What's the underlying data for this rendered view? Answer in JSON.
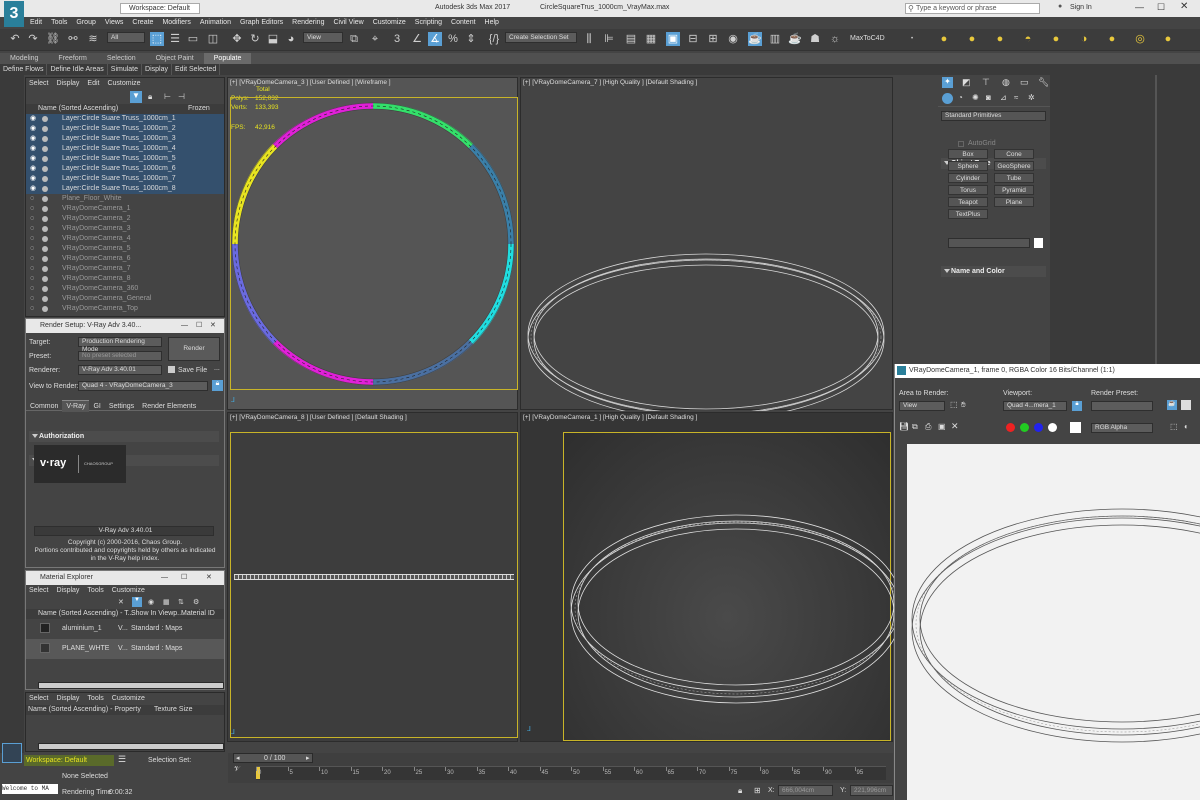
{
  "app": {
    "workspace_label": "Workspace: Default",
    "window_title": "Autodesk 3ds Max 2017",
    "file_name": "CircleSquareTrus_1000cm_VrayMax.max",
    "search_placeholder": "Type a keyword or phrase",
    "sign_in": "Sign In",
    "logo": "3"
  },
  "menu": [
    "Edit",
    "Tools",
    "Group",
    "Views",
    "Create",
    "Modifiers",
    "Animation",
    "Graph Editors",
    "Rendering",
    "Civil View",
    "Customize",
    "Scripting",
    "Content",
    "Help"
  ],
  "toolbar": {
    "selection_filter": "All",
    "ref_coord": "View",
    "named_selection": "Create Selection Set",
    "plugin_label": "MaxToC4D"
  },
  "ribbon_tabs": [
    "Modeling",
    "Freeform",
    "Selection",
    "Object Paint",
    "Populate"
  ],
  "ribbon_subtabs": [
    "Define Flows",
    "Define Idle Areas",
    "Simulate",
    "Display",
    "Edit Selected"
  ],
  "scene_explorer": {
    "menu": [
      "Select",
      "Display",
      "Edit",
      "Customize"
    ],
    "column_name": "Name (Sorted Ascending)",
    "column_frozen": "Frozen",
    "items": [
      {
        "label": "Layer:Circle Suare Truss_1000cm_1",
        "selected": true
      },
      {
        "label": "Layer:Circle Suare Truss_1000cm_2",
        "selected": true
      },
      {
        "label": "Layer:Circle Suare Truss_1000cm_3",
        "selected": true
      },
      {
        "label": "Layer:Circle Suare Truss_1000cm_4",
        "selected": true
      },
      {
        "label": "Layer:Circle Suare Truss_1000cm_5",
        "selected": true
      },
      {
        "label": "Layer:Circle Suare Truss_1000cm_6",
        "selected": true
      },
      {
        "label": "Layer:Circle Suare Truss_1000cm_7",
        "selected": true
      },
      {
        "label": "Layer:Circle Suare Truss_1000cm_8",
        "selected": true
      },
      {
        "label": "Plane_Floor_White",
        "selected": false
      },
      {
        "label": "VRayDomeCamera_1",
        "selected": false
      },
      {
        "label": "VRayDomeCamera_2",
        "selected": false
      },
      {
        "label": "VRayDomeCamera_3",
        "selected": false
      },
      {
        "label": "VRayDomeCamera_4",
        "selected": false
      },
      {
        "label": "VRayDomeCamera_5",
        "selected": false
      },
      {
        "label": "VRayDomeCamera_6",
        "selected": false
      },
      {
        "label": "VRayDomeCamera_7",
        "selected": false
      },
      {
        "label": "VRayDomeCamera_8",
        "selected": false
      },
      {
        "label": "VRayDomeCamera_360",
        "selected": false
      },
      {
        "label": "VRayDomeCamera_General",
        "selected": false
      },
      {
        "label": "VRayDomeCamera_Top",
        "selected": false
      }
    ]
  },
  "render_setup": {
    "title": "Render Setup: V-Ray Adv 3.40...",
    "target_label": "Target:",
    "target_value": "Production Rendering Mode",
    "preset_label": "Preset:",
    "preset_value": "No preset selected",
    "renderer_label": "Renderer:",
    "renderer_value": "V-Ray Adv 3.40.01",
    "save_file": "Save File",
    "render_button": "Render",
    "view_label": "View to Render:",
    "view_value": "Quad 4 - VRayDomeCamera_3",
    "tabs": [
      "Common",
      "V-Ray",
      "GI",
      "Settings",
      "Render Elements"
    ],
    "rollout_authorization": "Authorization",
    "rollout_about": "About V-Ray",
    "vray_logo": "v·ray",
    "chaos_logo": "CHAOSGROUP",
    "version_box": "V-Ray Adv 3.40.01",
    "copyright_1": "Copyright (c) 2000-2016, Chaos Group.",
    "copyright_2": "Portions contributed and copyrights held by others as indicated",
    "copyright_3": "in the V-Ray help index."
  },
  "material_explorer": {
    "title": "Material Explorer",
    "menu": [
      "Select",
      "Display",
      "Tools",
      "Customize"
    ],
    "columns": [
      "Name (Sorted Ascending) - T...",
      "Show In Viewp...",
      "Material ID"
    ],
    "rows": [
      {
        "name": "aluminium_1",
        "type": "V...",
        "maps": "Standard : Maps"
      },
      {
        "name": "PLANE_WHTE",
        "type": "V...",
        "maps": "Standard : Maps"
      }
    ],
    "menu2": [
      "Select",
      "Display",
      "Tools",
      "Customize"
    ],
    "columns2": [
      "Name (Sorted Ascending) - Property",
      "Texture Size"
    ]
  },
  "viewports": {
    "top_left": {
      "label": "[+] [VRayDomeCamera_3 ] [User Defined ] [Wireframe ]",
      "stats_total": "Total",
      "polys_label": "Polys:",
      "polys": "152,032",
      "verts_label": "Verts:",
      "verts": "133,393",
      "fps_label": "FPS:",
      "fps": "42,916"
    },
    "top_right": {
      "label": "[+] [VRayDomeCamera_7 ] [High Quality ] [Default Shading ]"
    },
    "bottom_left": {
      "label": "[+] [VRayDomeCamera_8 ] [User Defined ] [Default Shading ]"
    },
    "bottom_right": {
      "label": "[+] [VRayDomeCamera_1 ] [High Quality ] [Default Shading ]"
    }
  },
  "command_panel": {
    "dropdown": "Standard Primitives",
    "object_type": "Object Type",
    "autogrid": "AutoGrid",
    "buttons": [
      "Box",
      "Cone",
      "Sphere",
      "GeoSphere",
      "Cylinder",
      "Tube",
      "Torus",
      "Pyramid",
      "Teapot",
      "Plane",
      "TextPlus"
    ],
    "name_and_color": "Name and Color"
  },
  "frame_buffer": {
    "title": "VRayDomeCamera_1, frame 0, RGBA Color 16 Bits/Channel (1:1)",
    "area_label": "Area to Render:",
    "area_value": "View",
    "viewport_label": "Viewport:",
    "viewport_value": "Quad 4...mera_1",
    "preset_label": "Render Preset:",
    "channel": "RGB Alpha"
  },
  "timeline": {
    "frame_counter": "0 / 100",
    "ticks": [
      "0",
      "5",
      "10",
      "15",
      "20",
      "25",
      "30",
      "35",
      "40",
      "45",
      "50",
      "55",
      "60",
      "65",
      "70",
      "75",
      "80",
      "85",
      "90",
      "95"
    ]
  },
  "status": {
    "workspace": "Workspace: Default",
    "selection_set": "Selection Set:",
    "maxscript": "Welcome to MA",
    "none_selected": "None Selected",
    "render_time_label": "Rendering Time",
    "render_time": "0:00:32",
    "x_label": "X:",
    "x_value": "666,004cm",
    "y_label": "Y:",
    "y_value": "221,996cm"
  },
  "colors": {
    "selection_blue": "#34506d",
    "accent": "#5a9fd4",
    "ring_segments": [
      "#33e06a",
      "#3a7fa8",
      "#20dde0",
      "#4a6fa0",
      "#e020d8",
      "#6a6ae0",
      "#e8e420",
      "#e020d8"
    ]
  }
}
